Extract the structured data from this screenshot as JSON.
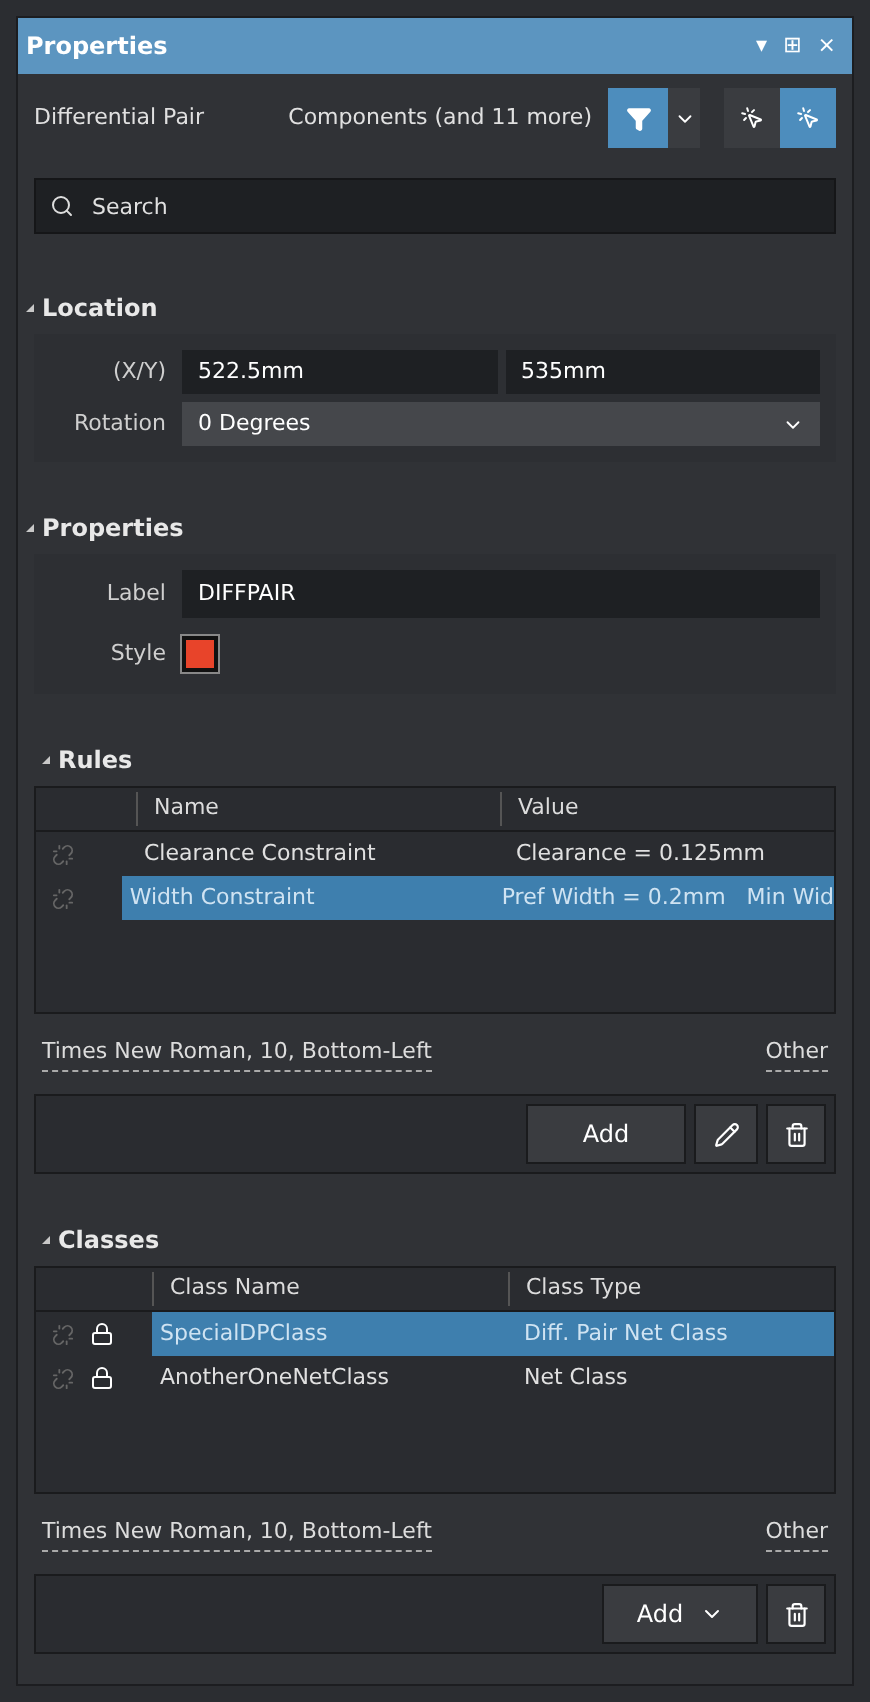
{
  "window": {
    "title": "Properties",
    "controls": [
      "▾",
      "⊞",
      "×"
    ]
  },
  "header": {
    "object": "Differential Pair",
    "filter": "Components (and 11 more)",
    "filter_on": true,
    "select_buttons": [
      {
        "selected": false
      },
      {
        "selected": true
      }
    ]
  },
  "search": {
    "placeholder": "Search"
  },
  "location": {
    "title": "Location",
    "expanded": true,
    "xy_label": "(X/Y)",
    "x": "522.5mm",
    "y": "535mm",
    "rotation_label": "Rotation",
    "rotation": "0 Degrees"
  },
  "properties": {
    "title": "Properties",
    "expanded": true,
    "label_label": "Label",
    "label": "DIFFPAIR",
    "style": {
      "label": "Style",
      "color": "#e8442a"
    }
  },
  "rules": {
    "title": "Rules",
    "expanded": true,
    "columns": [
      "Name",
      "Value"
    ],
    "rows": [
      {
        "name": "Clearance Constraint",
        "value": "Clearance = 0.125mm",
        "selected": false
      },
      {
        "name": "Width Constraint",
        "value": "Pref Width = 0.2mm   Min Wid",
        "selected": true
      }
    ],
    "font": "Times New Roman, 10, Bottom-Left",
    "other": "Other",
    "add": "Add"
  },
  "classes": {
    "title": "Classes",
    "expanded": true,
    "columns": [
      "Class Name",
      "Class Type"
    ],
    "rows": [
      {
        "name": "SpecialDPClass",
        "type": "Diff. Pair Net Class",
        "selected": true
      },
      {
        "name": "AnotherOneNetClass",
        "type": "Net Class",
        "selected": false
      }
    ],
    "font": "Times New Roman, 10, Bottom-Left",
    "other": "Other",
    "add": "Add"
  }
}
